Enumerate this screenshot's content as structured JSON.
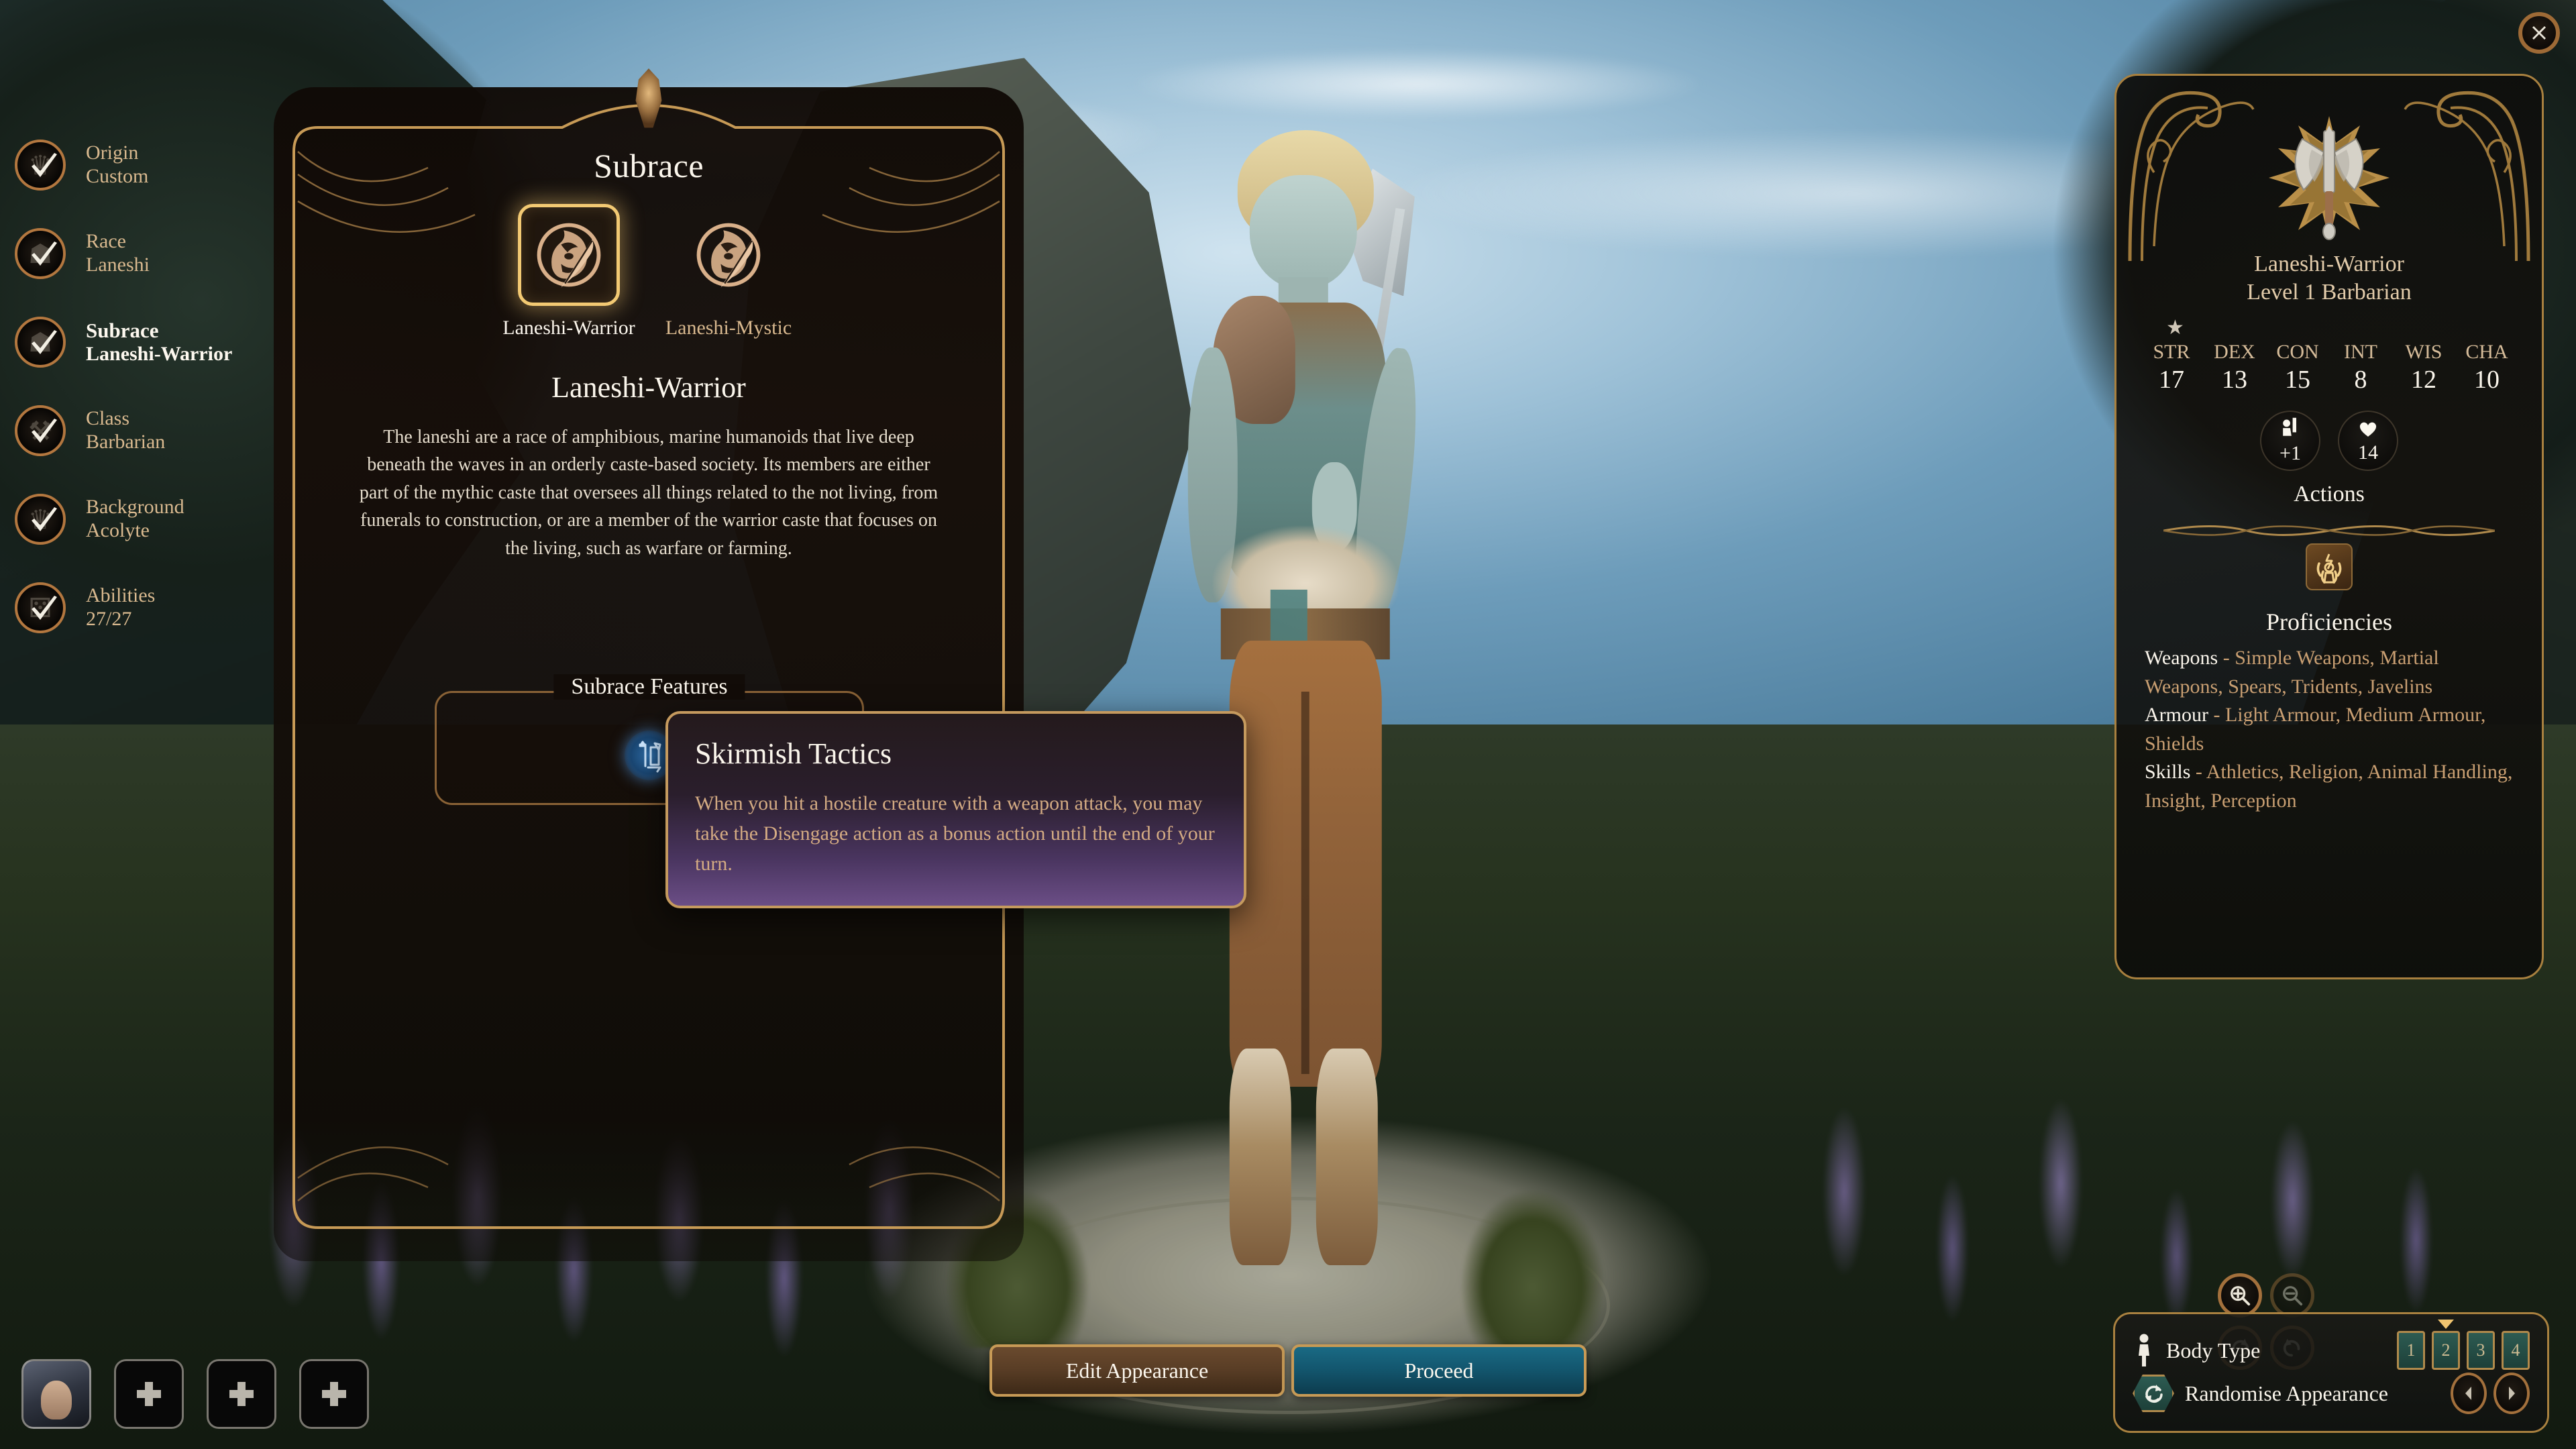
{
  "sidebar": {
    "items": [
      {
        "title": "Origin",
        "value": "Custom",
        "icon": "crown-shield-icon",
        "active": false
      },
      {
        "title": "Race",
        "value": "Laneshi",
        "icon": "race-helm-icon",
        "active": false
      },
      {
        "title": "Subrace",
        "value": "Laneshi-Warrior",
        "icon": "race-helm-icon",
        "active": true
      },
      {
        "title": "Class",
        "value": "Barbarian",
        "icon": "crossed-axes-icon",
        "active": false
      },
      {
        "title": "Background",
        "value": "Acolyte",
        "icon": "crown-shield-icon",
        "active": false
      },
      {
        "title": "Abilities",
        "value": "27/27",
        "icon": "dice-icon",
        "active": false
      }
    ]
  },
  "subrace_panel": {
    "title": "Subrace",
    "choices": [
      {
        "label": "Laneshi-Warrior",
        "icon": "laneshi-feather-icon",
        "selected": true
      },
      {
        "label": "Laneshi-Mystic",
        "icon": "laneshi-feather-icon",
        "selected": false
      }
    ],
    "selected_name": "Laneshi-Warrior",
    "description": "The laneshi are a race of amphibious, marine humanoids that live deep beneath the waves in an orderly caste-based society. Its members are either part of the mythic caste that oversees all things related to the not living, from funerals to construction, or are a member of the warrior caste that focuses on the living, such as warfare or farming.",
    "features_title": "Subrace Features",
    "feature_icon": "skirmish-tactics-icon"
  },
  "tooltip": {
    "title": "Skirmish Tactics",
    "body": "When you hit a hostile creature with a weapon attack, you may take the Disengage action as a bonus action until the end of your turn."
  },
  "character_panel": {
    "class_emblem": "barbarian-axe-emblem",
    "name": "Laneshi-Warrior",
    "level": "Level 1 Barbarian",
    "star_icon": "star-icon",
    "abilities": [
      {
        "key": "STR",
        "value": "17"
      },
      {
        "key": "DEX",
        "value": "13"
      },
      {
        "key": "CON",
        "value": "15"
      },
      {
        "key": "INT",
        "value": "8"
      },
      {
        "key": "WIS",
        "value": "12"
      },
      {
        "key": "CHA",
        "value": "10"
      }
    ],
    "badges": [
      {
        "icon": "armour-class-icon",
        "value": "+1"
      },
      {
        "icon": "heart-icon",
        "value": "14"
      }
    ],
    "actions_label": "Actions",
    "action_icons": [
      "rage-icon"
    ],
    "proficiencies_title": "Proficiencies",
    "proficiencies": [
      {
        "label": "Weapons",
        "value": "Simple Weapons, Martial Weapons, Spears, Tridents, Javelins"
      },
      {
        "label": "Armour",
        "value": "Light Armour, Medium Armour, Shields"
      },
      {
        "label": "Skills",
        "value": "Athletics, Religion, Animal Handling, Insight, Perception"
      }
    ]
  },
  "bottom": {
    "edit_appearance_label": "Edit Appearance",
    "proceed_label": "Proceed"
  },
  "party_bar": {
    "slots": [
      {
        "type": "portrait",
        "icon": "character-portrait"
      },
      {
        "type": "empty",
        "icon": "add-character-icon"
      },
      {
        "type": "empty",
        "icon": "add-character-icon"
      },
      {
        "type": "empty",
        "icon": "add-character-icon"
      }
    ]
  },
  "camera_controls": [
    {
      "icon": "zoom-in-icon",
      "enabled": true
    },
    {
      "icon": "zoom-out-icon",
      "enabled": false
    },
    {
      "icon": "rotate-right-icon",
      "enabled": true
    },
    {
      "icon": "rotate-left-icon",
      "enabled": true
    }
  ],
  "appearance_panel": {
    "body_type_icon": "body-silhouette-icon",
    "body_type_label": "Body Type",
    "body_type_options": [
      "1",
      "2",
      "3",
      "4"
    ],
    "body_type_selected": "2",
    "randomise_icon": "refresh-icon",
    "randomise_label": "Randomise Appearance",
    "prev_icon": "chevron-left-icon",
    "next_icon": "chevron-right-icon"
  },
  "close_button": {
    "icon": "close-icon"
  },
  "colors": {
    "gold": "#c79a56",
    "gold_bright": "#f2c973",
    "tan": "#d9b98f",
    "cream": "#fbf6ec",
    "bronze": "#a3703c",
    "teal": "#13576f",
    "tooltip_purple": "#6b4e86"
  }
}
